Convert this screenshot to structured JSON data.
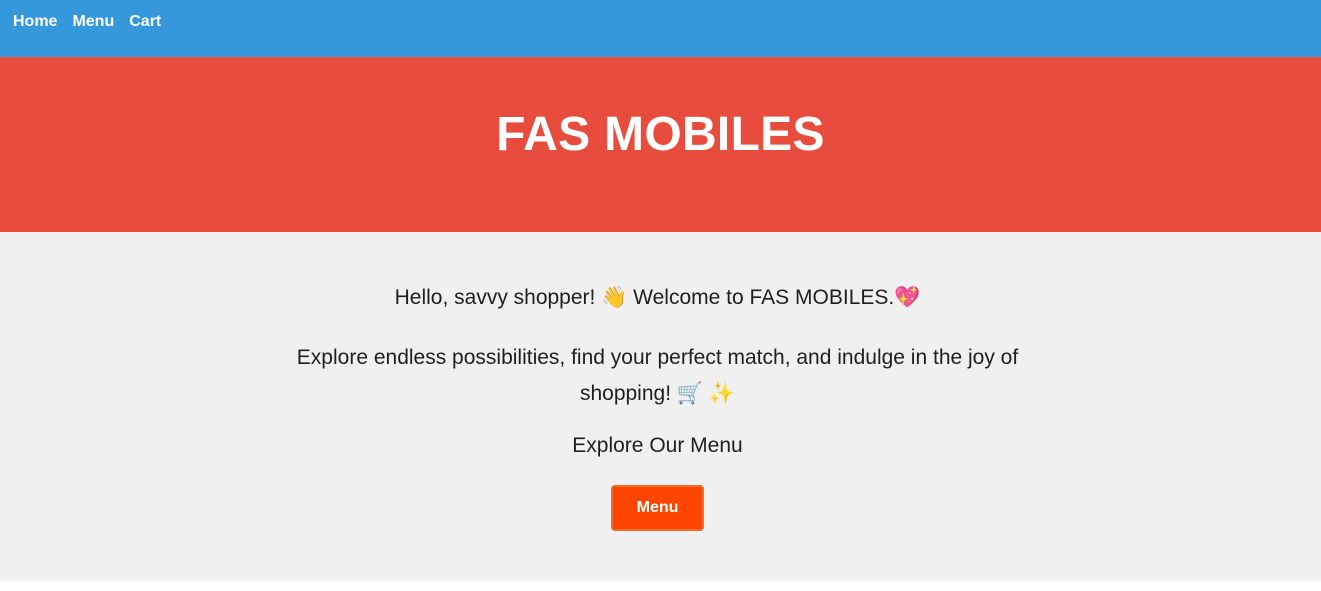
{
  "colors": {
    "navbar_bg": "#3498db",
    "hero_bg": "#e74c3c",
    "content_bg": "#f0f0f0",
    "button_bg": "#ff4500"
  },
  "nav": {
    "items": [
      {
        "label": "Home"
      },
      {
        "label": "Menu"
      },
      {
        "label": "Cart"
      }
    ]
  },
  "hero": {
    "title": "FAS MOBILES"
  },
  "content": {
    "greeting": "Hello, savvy shopper! 👋 Welcome to FAS MOBILES.💖",
    "tagline": "Explore endless possibilities, find your perfect match, and indulge in the joy of shopping! 🛒 ✨",
    "explore_heading": "Explore Our Menu",
    "menu_button_label": "Menu"
  }
}
